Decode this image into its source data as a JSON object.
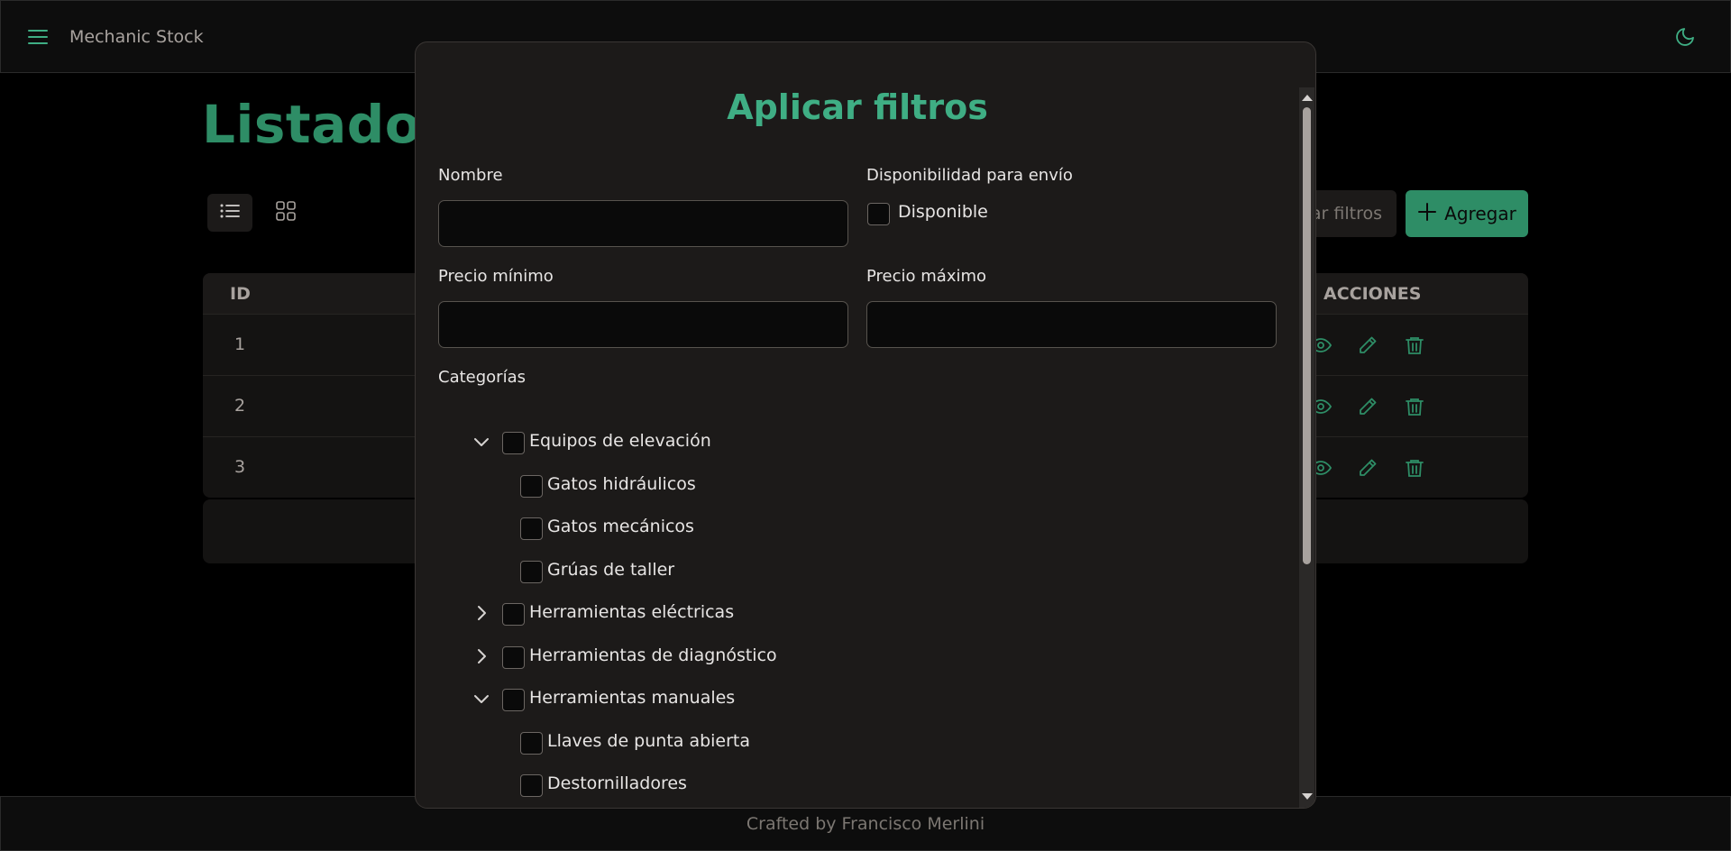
{
  "navbar": {
    "app_title": "Mechanic Stock",
    "menu_icon": "hamburger-icon",
    "theme_icon": "moon-icon"
  },
  "page": {
    "title": "Listado de",
    "clear_filters_label": "ar filtros",
    "add_label": "Agregar"
  },
  "table": {
    "headers": {
      "id": "ID",
      "actions": "ACCIONES"
    },
    "rows": [
      {
        "id": "1"
      },
      {
        "id": "2"
      },
      {
        "id": "3"
      }
    ]
  },
  "footer": {
    "text": "Crafted by Francisco Merlini"
  },
  "modal": {
    "title": "Aplicar filtros",
    "name_label": "Nombre",
    "name_value": "",
    "availability_label": "Disponibilidad para envío",
    "available_label": "Disponible",
    "min_price_label": "Precio mínimo",
    "min_price_value": "",
    "max_price_label": "Precio máximo",
    "max_price_value": "",
    "categories_label": "Categorías",
    "categories": [
      {
        "label": "Equipos de elevación",
        "expanded": true
      },
      {
        "label": "Gatos hidráulicos"
      },
      {
        "label": "Gatos mecánicos"
      },
      {
        "label": "Grúas de taller"
      },
      {
        "label": "Herramientas eléctricas",
        "expanded": false
      },
      {
        "label": "Herramientas de diagnóstico",
        "expanded": false
      },
      {
        "label": "Herramientas manuales",
        "expanded": true
      },
      {
        "label": "Llaves de punta abierta"
      },
      {
        "label": "Destornilladores"
      }
    ]
  },
  "colors": {
    "accent": "#3fae84",
    "accent_dark": "#2e8d66",
    "background": "#000000",
    "modal_bg": "#1c1a19"
  }
}
